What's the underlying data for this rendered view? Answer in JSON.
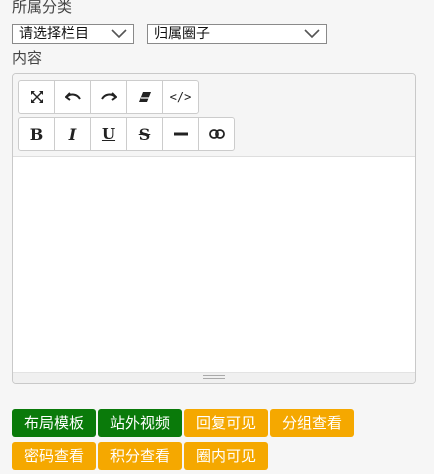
{
  "category_section": {
    "label": "所属分类",
    "column_select": "请选择栏目",
    "circle_select": "归属圈子"
  },
  "content_section": {
    "label": "内容"
  },
  "toolbar": {
    "row1": [
      {
        "name": "fullscreen-icon",
        "glyph": "⤧"
      },
      {
        "name": "undo-icon",
        "glyph": "↶"
      },
      {
        "name": "redo-icon",
        "glyph": "↷"
      },
      {
        "name": "eraser-icon",
        "glyph": "▰"
      },
      {
        "name": "code-icon",
        "glyph": "</>"
      }
    ],
    "row2": [
      {
        "name": "bold-icon",
        "glyph": "B"
      },
      {
        "name": "italic-icon",
        "glyph": "I"
      },
      {
        "name": "underline-icon",
        "glyph": "U"
      },
      {
        "name": "strikethrough-icon",
        "glyph": "S"
      },
      {
        "name": "horizontal-rule-icon",
        "glyph": "—"
      },
      {
        "name": "link-icon",
        "glyph": "⊝"
      }
    ]
  },
  "tags": {
    "layout_template": "布局模板",
    "external_video": "站外视频",
    "reply_visible": "回复可见",
    "group_view": "分组查看",
    "password_view": "密码查看",
    "points_view": "积分查看",
    "circle_visible": "圈内可见"
  },
  "colors": {
    "green": "#0a7a0a",
    "orange": "#f5a800"
  }
}
